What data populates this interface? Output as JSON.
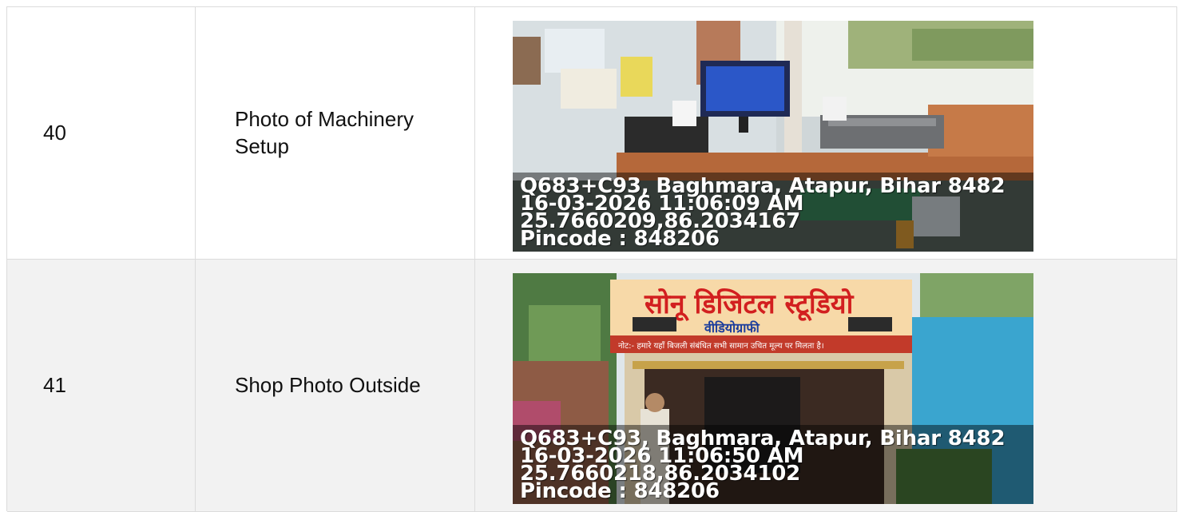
{
  "rows": [
    {
      "number": "40",
      "label": "Photo of Machinery Setup",
      "photo": {
        "scene": "indoor-machinery-setup",
        "overlay_lines": [
          "Q683+C93, Baghmara, Atapur, Bihar 8482",
          "16-03-2026 11:06:09 AM",
          "25.7660209,86.2034167",
          "Pincode : 848206"
        ]
      }
    },
    {
      "number": "41",
      "label": "Shop Photo Outside",
      "photo": {
        "scene": "shop-front-outside",
        "signboard_text": "सोनू डिजिटल स्टूडियो",
        "signboard_subtext": "वीडियोग्राफी",
        "signboard_notice": "नोट:- हमारे यहाँ बिजली संबंधित सभी सामान उचित मूल्य पर मिलता है।",
        "overlay_lines": [
          "Q683+C93, Baghmara, Atapur, Bihar 8482",
          "16-03-2026 11:06:50 AM",
          "25.7660218,86.2034102",
          "Pincode : 848206"
        ]
      }
    }
  ],
  "colors": {
    "border": "#dcdcdc",
    "row_alt_bg": "#f2f2f2",
    "signboard_bg": "#f7d9a8",
    "signboard_title": "#d21f1f",
    "shop_wall": "#3aa5cf"
  }
}
